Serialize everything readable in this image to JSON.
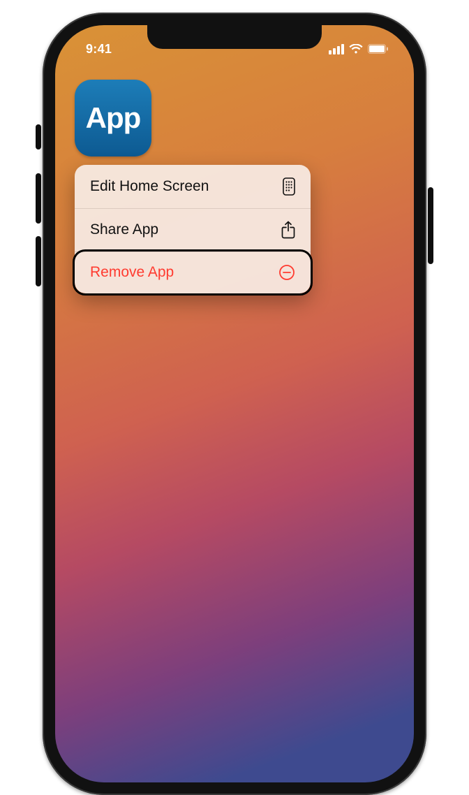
{
  "status": {
    "time": "9:41"
  },
  "app": {
    "label": "App"
  },
  "menu": {
    "items": [
      {
        "label": "Edit Home Screen",
        "icon": "apps-grid-icon",
        "danger": false
      },
      {
        "label": "Share App",
        "icon": "share-icon",
        "danger": false
      },
      {
        "label": "Remove App",
        "icon": "remove-icon",
        "danger": true
      }
    ]
  }
}
